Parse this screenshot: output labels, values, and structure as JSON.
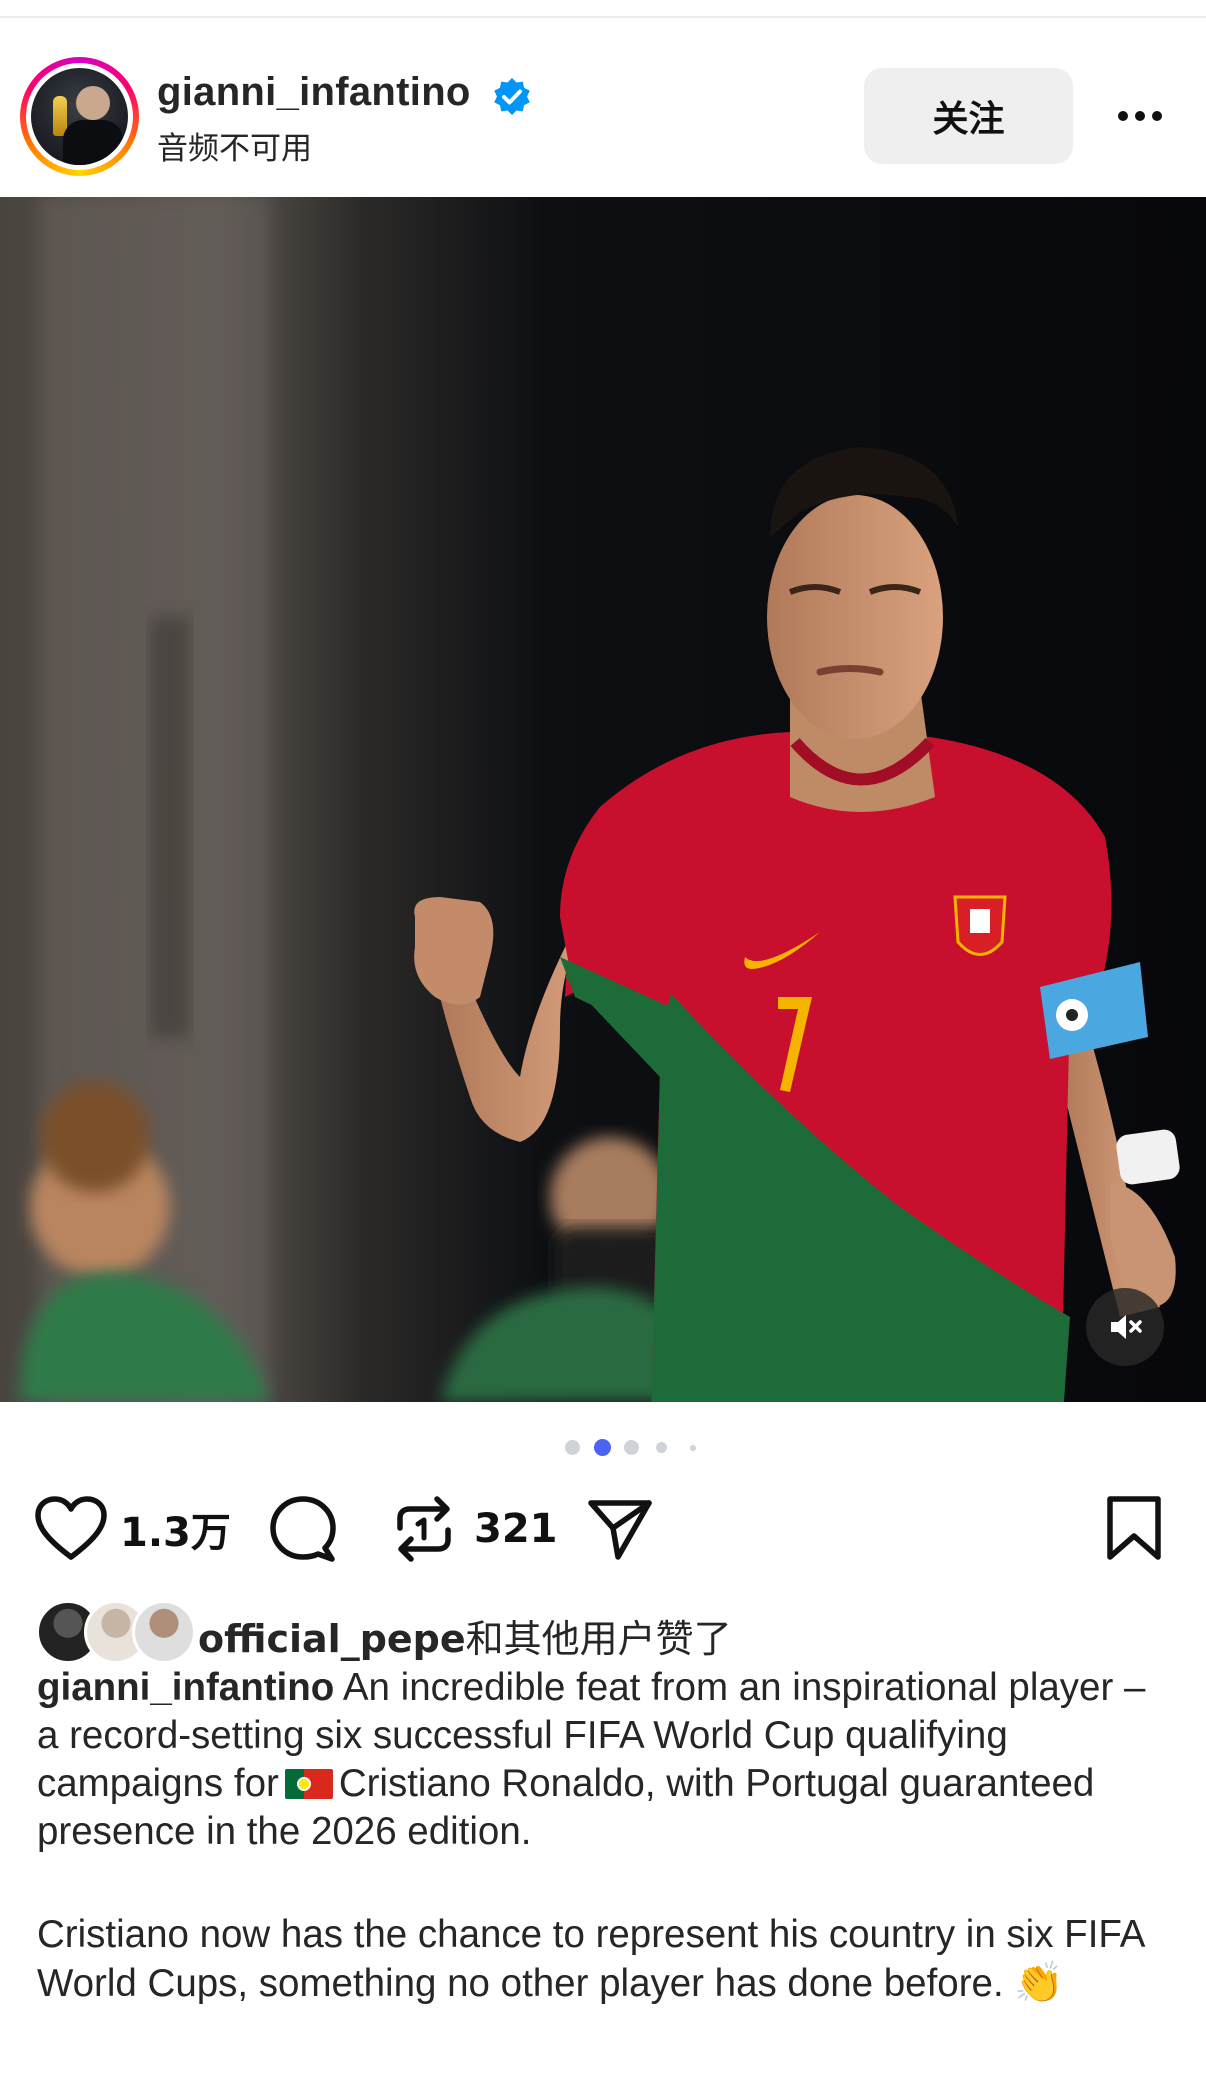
{
  "header": {
    "username": "gianni_infantino",
    "subtitle": "音频不可用",
    "follow_label": "关注"
  },
  "photo": {
    "slide_count": 5,
    "active_slide": 2,
    "jersey_number": "7"
  },
  "actions": {
    "likes_count": "1.3万",
    "reposts_count": "321"
  },
  "likes_line": {
    "lead_user": "official_pepe",
    "suffix": "和其他用户赞了"
  },
  "caption": {
    "username": "gianni_infantino",
    "paragraph1_a": "An incredible feat from an inspirational player – a record-setting six successful FIFA World Cup qualifying campaigns for",
    "paragraph1_b": "Cristiano Ronaldo, with Portugal guaranteed presence in the 2026 edition.",
    "paragraph2": "Cristiano now has the chance to represent his country in six FIFA World Cups, something no other player has done before.",
    "emoji": "👏"
  },
  "colors": {
    "verified_blue": "#0095f6",
    "active_dot": "#4a63f5",
    "jersey_red": "#c8102e",
    "jersey_green": "#1e6b3a"
  },
  "icons": [
    "verified-badge-icon",
    "more-options-icon",
    "mute-icon",
    "heart-icon",
    "comment-icon",
    "repost-icon",
    "share-icon",
    "bookmark-icon"
  ]
}
